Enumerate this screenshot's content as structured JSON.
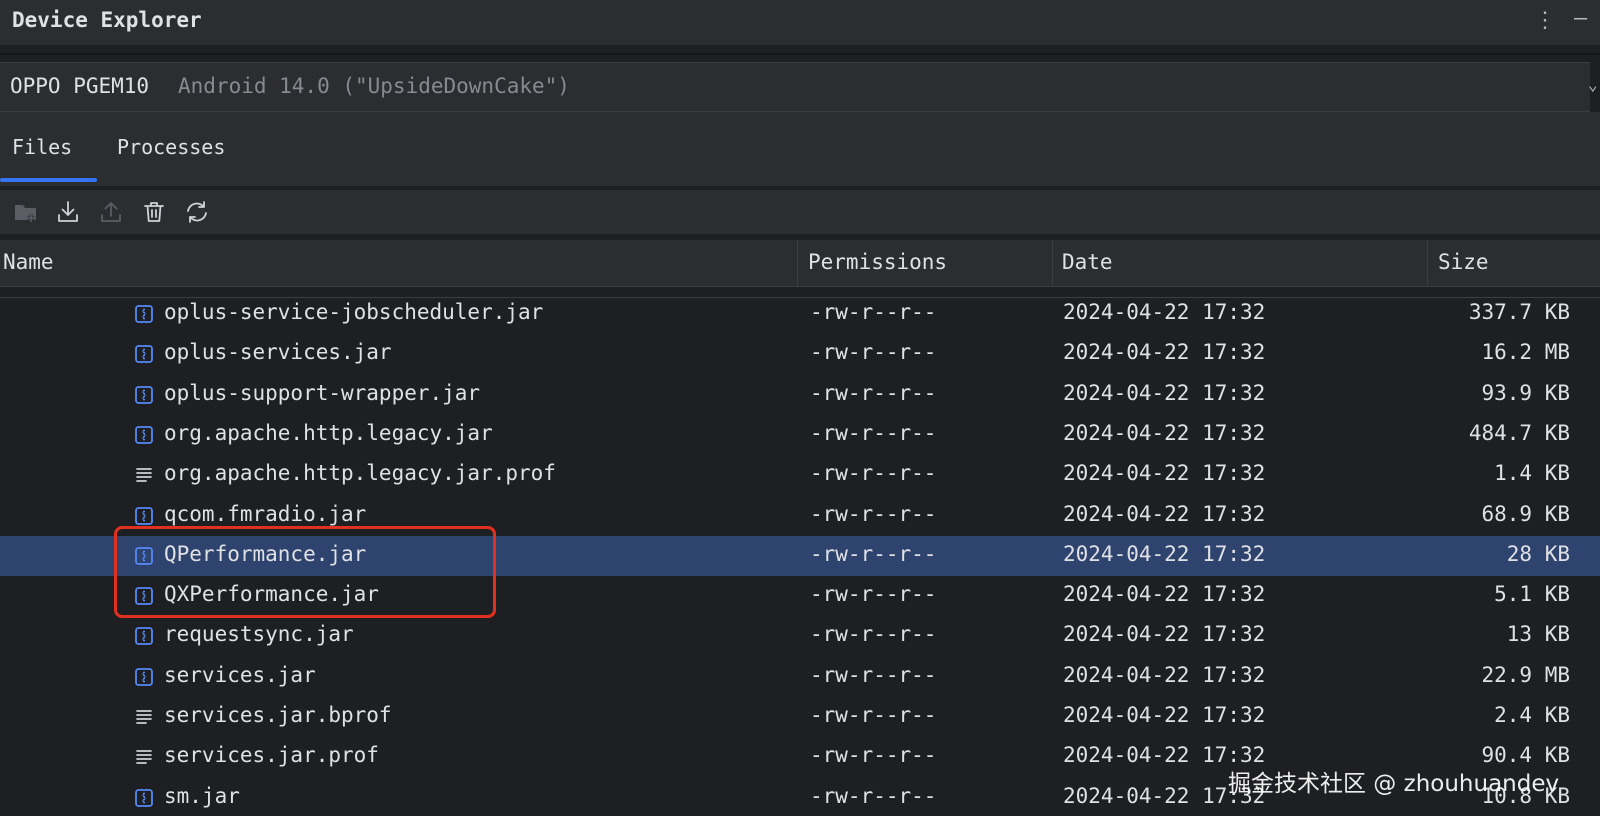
{
  "window": {
    "title": "Device Explorer"
  },
  "device": {
    "name": "OPPO PGEM10",
    "version": "Android 14.0 (\"UpsideDownCake\")"
  },
  "tabs": [
    {
      "label": "Files",
      "active": true
    },
    {
      "label": "Processes",
      "active": false
    }
  ],
  "toolbar": {
    "buttons": [
      {
        "icon": "new-folder-icon",
        "enabled": false
      },
      {
        "icon": "download-icon",
        "enabled": true
      },
      {
        "icon": "upload-icon",
        "enabled": false
      },
      {
        "icon": "delete-icon",
        "enabled": true
      },
      {
        "icon": "refresh-icon",
        "enabled": true
      }
    ]
  },
  "table": {
    "columns": [
      "Name",
      "Permissions",
      "Date",
      "Size"
    ],
    "rows": [
      {
        "name": "oplus-service-jobscheduler.jar",
        "icon": "jar-file-icon",
        "permissions": "-rw-r--r--",
        "date": "2024-04-22 17:32",
        "size": "337.7 KB"
      },
      {
        "name": "oplus-services.jar",
        "icon": "jar-file-icon",
        "permissions": "-rw-r--r--",
        "date": "2024-04-22 17:32",
        "size": "16.2 MB"
      },
      {
        "name": "oplus-support-wrapper.jar",
        "icon": "jar-file-icon",
        "permissions": "-rw-r--r--",
        "date": "2024-04-22 17:32",
        "size": "93.9 KB"
      },
      {
        "name": "org.apache.http.legacy.jar",
        "icon": "jar-file-icon",
        "permissions": "-rw-r--r--",
        "date": "2024-04-22 17:32",
        "size": "484.7 KB"
      },
      {
        "name": "org.apache.http.legacy.jar.prof",
        "icon": "text-file-icon",
        "permissions": "-rw-r--r--",
        "date": "2024-04-22 17:32",
        "size": "1.4 KB"
      },
      {
        "name": "qcom.fmradio.jar",
        "icon": "jar-file-icon",
        "permissions": "-rw-r--r--",
        "date": "2024-04-22 17:32",
        "size": "68.9 KB"
      },
      {
        "name": "QPerformance.jar",
        "icon": "jar-file-icon",
        "permissions": "-rw-r--r--",
        "date": "2024-04-22 17:32",
        "size": "28 KB",
        "selected": true
      },
      {
        "name": "QXPerformance.jar",
        "icon": "jar-file-icon",
        "permissions": "-rw-r--r--",
        "date": "2024-04-22 17:32",
        "size": "5.1 KB"
      },
      {
        "name": "requestsync.jar",
        "icon": "jar-file-icon",
        "permissions": "-rw-r--r--",
        "date": "2024-04-22 17:32",
        "size": "13 KB"
      },
      {
        "name": "services.jar",
        "icon": "jar-file-icon",
        "permissions": "-rw-r--r--",
        "date": "2024-04-22 17:32",
        "size": "22.9 MB"
      },
      {
        "name": "services.jar.bprof",
        "icon": "text-file-icon",
        "permissions": "-rw-r--r--",
        "date": "2024-04-22 17:32",
        "size": "2.4 KB"
      },
      {
        "name": "services.jar.prof",
        "icon": "text-file-icon",
        "permissions": "-rw-r--r--",
        "date": "2024-04-22 17:32",
        "size": "90.4 KB"
      },
      {
        "name": "sm.jar",
        "icon": "jar-file-icon",
        "permissions": "-rw-r--r--",
        "date": "2024-04-22 17:32",
        "size": "10.8 KB"
      }
    ]
  },
  "watermark": "掘金技术社区 @ zhouhuandev",
  "colors": {
    "accent": "#3574f0",
    "selection": "#2e436e",
    "annotation": "#e0311f"
  }
}
